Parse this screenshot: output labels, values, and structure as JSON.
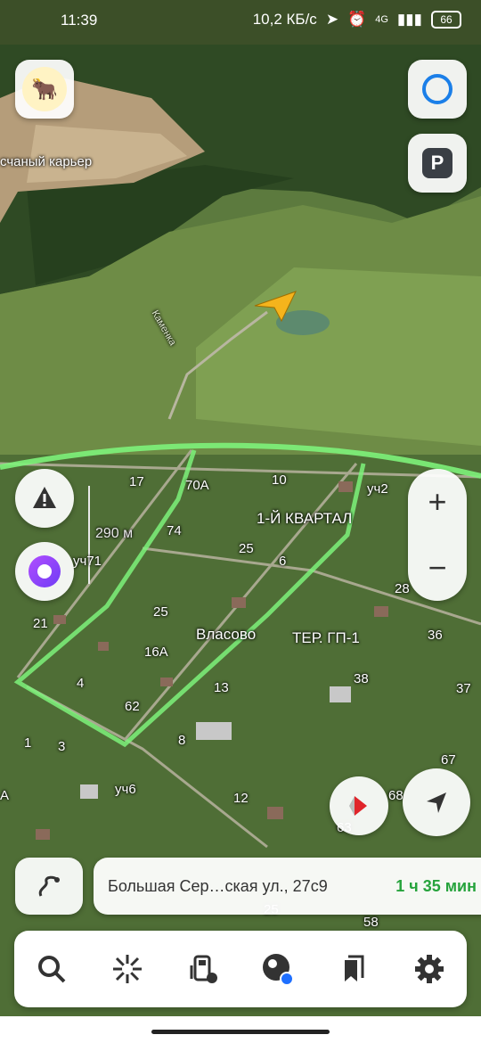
{
  "status_bar": {
    "time": "11:39",
    "network_speed": "10,2 КБ/с",
    "network_type": "4G",
    "battery": "66"
  },
  "map": {
    "labels": {
      "quarry": "счаный карьер",
      "quarter": "1-Й КВАРТАЛ",
      "vlasovo": "Власово",
      "ter_gp": "ТЕР. ГП-1",
      "scale": "290 м",
      "river": "Каменка"
    },
    "house_numbers": [
      "17",
      "70А",
      "10",
      "уч2",
      "74",
      "25",
      "6",
      "уч71",
      "28",
      "21",
      "25",
      "16А",
      "36",
      "4",
      "13",
      "38",
      "37",
      "62",
      "1",
      "3",
      "8",
      "67",
      "А",
      "уч6",
      "12",
      "68",
      "63",
      "58",
      "25"
    ]
  },
  "route": {
    "address": "Большая Сер…ская ул., 27с9",
    "eta": "1 ч 35 мин"
  },
  "colors": {
    "route": "#7df27a",
    "eta": "#26a33c",
    "alice": "#6f3df5",
    "arrow": "#f5b41c"
  },
  "icons": {
    "avatar": "yak-avatar-icon",
    "assistant": "alice-ring-icon",
    "parking": "parking-icon",
    "warning": "warning-icon",
    "alice": "alice-icon",
    "zoom_in": "plus-icon",
    "zoom_out": "minus-icon",
    "compass": "compass-icon",
    "location": "navigation-arrow-icon",
    "route": "route-icon",
    "search": "search-icon",
    "discover": "sparkle-icon",
    "fuel": "fuel-icon",
    "music": "music-icon",
    "bookmarks": "bookmarks-icon",
    "settings": "gear-icon"
  }
}
